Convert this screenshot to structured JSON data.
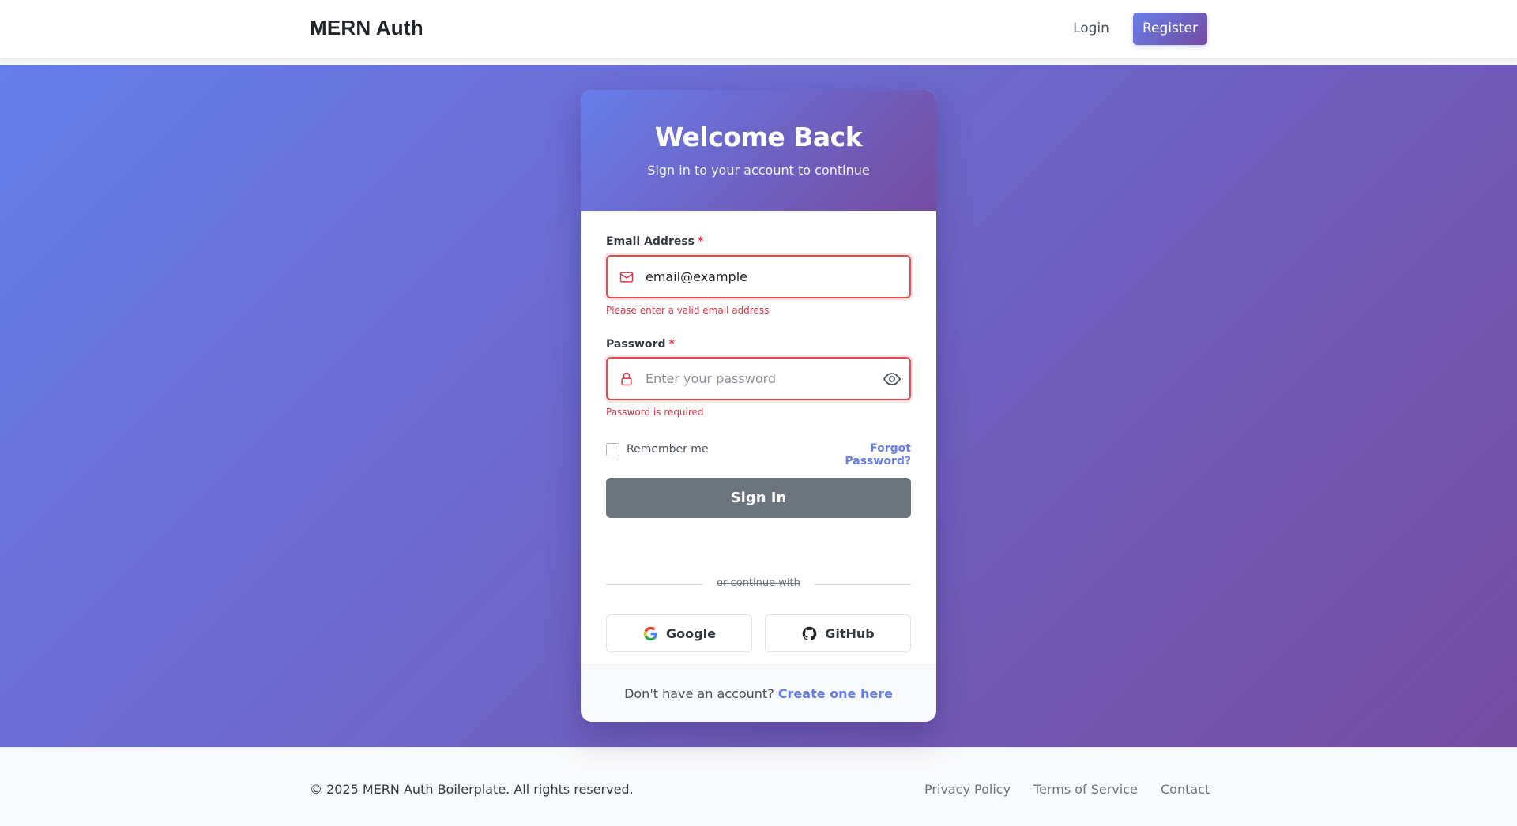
{
  "navbar": {
    "brand": "MERN Auth",
    "login_label": "Login",
    "register_label": "Register"
  },
  "card": {
    "title": "Welcome Back",
    "subtitle": "Sign in to your account to continue"
  },
  "form": {
    "email": {
      "label": "Email Address",
      "required_marker": "*",
      "value": "email@example",
      "error": "Please enter a valid email address",
      "icon": "mail-icon"
    },
    "password": {
      "label": "Password",
      "required_marker": "*",
      "value": "",
      "placeholder": "Enter your password",
      "error": "Password is required",
      "icon": "lock-icon",
      "toggle_icon": "eye-icon"
    },
    "remember_label": "Remember me",
    "remember_checked": false,
    "forgot_label": "Forgot Password?",
    "submit_label": "Sign In"
  },
  "social": {
    "divider_text": "or continue with",
    "google_label": "Google",
    "github_label": "GitHub"
  },
  "card_footer": {
    "prompt": "Don't have an account?",
    "link": "Create one here"
  },
  "footer": {
    "copyright": "© 2025 MERN Auth Boilerplate. All rights reserved.",
    "links": [
      "Privacy Policy",
      "Terms of Service",
      "Contact"
    ]
  },
  "colors": {
    "gradient_start": "#667eea",
    "gradient_end": "#764ba2",
    "error": "#dc3545",
    "button_disabled": "#6c757d"
  }
}
